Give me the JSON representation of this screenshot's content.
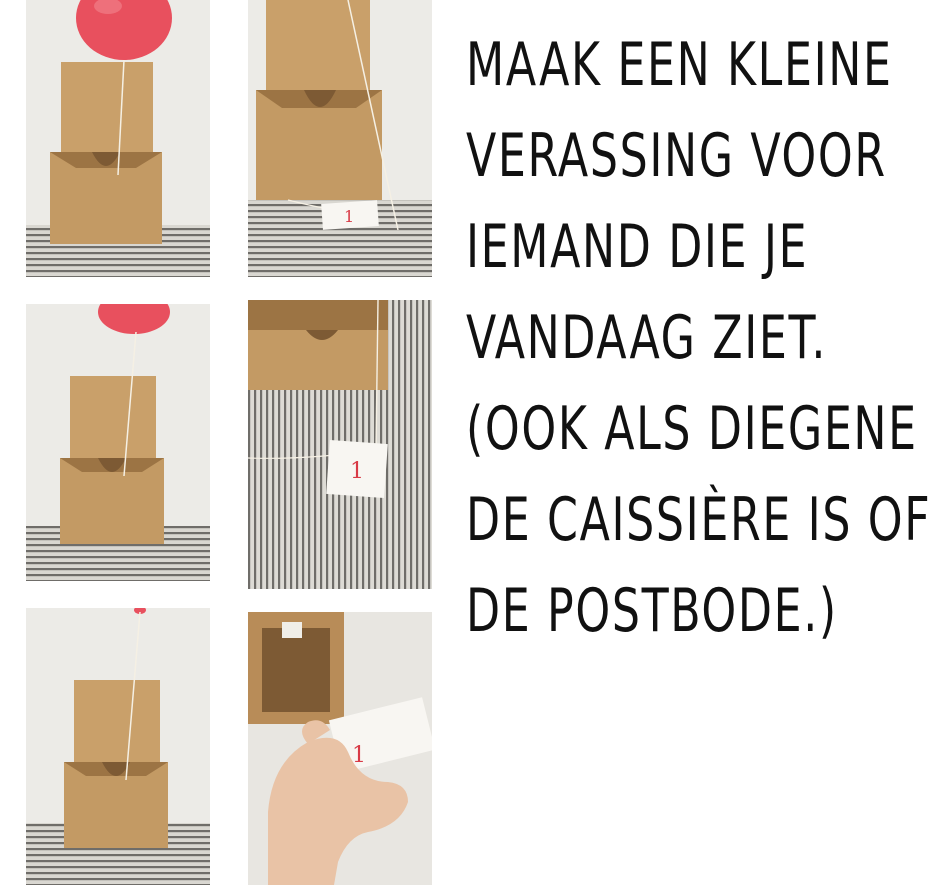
{
  "caption": {
    "lines": [
      "MAAK EEN KLEINE",
      "VERASSING VOOR",
      "IEMAND DIE JE",
      "VANDAAG ZIET.",
      "(OOK ALS DIEGENE",
      "DE CAISSIÈRE IS OF",
      "DE POSTBODE.)"
    ]
  },
  "photos": {
    "tag_number": "1"
  },
  "colors": {
    "balloon": "#e8505e",
    "kraft": "#c9a06a",
    "kraft_dark": "#9c7444",
    "stripe_light": "#d8d6d0",
    "stripe_dark": "#6e6c68",
    "wall": "#ecebe7"
  }
}
